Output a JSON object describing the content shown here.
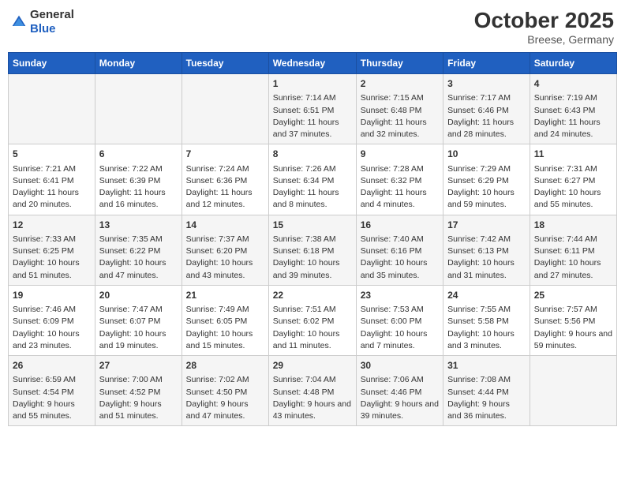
{
  "header": {
    "logo_general": "General",
    "logo_blue": "Blue",
    "month": "October 2025",
    "location": "Breese, Germany"
  },
  "days_of_week": [
    "Sunday",
    "Monday",
    "Tuesday",
    "Wednesday",
    "Thursday",
    "Friday",
    "Saturday"
  ],
  "weeks": [
    [
      {
        "day": "",
        "sunrise": "",
        "sunset": "",
        "daylight": ""
      },
      {
        "day": "",
        "sunrise": "",
        "sunset": "",
        "daylight": ""
      },
      {
        "day": "",
        "sunrise": "",
        "sunset": "",
        "daylight": ""
      },
      {
        "day": "1",
        "sunrise": "Sunrise: 7:14 AM",
        "sunset": "Sunset: 6:51 PM",
        "daylight": "Daylight: 11 hours and 37 minutes."
      },
      {
        "day": "2",
        "sunrise": "Sunrise: 7:15 AM",
        "sunset": "Sunset: 6:48 PM",
        "daylight": "Daylight: 11 hours and 32 minutes."
      },
      {
        "day": "3",
        "sunrise": "Sunrise: 7:17 AM",
        "sunset": "Sunset: 6:46 PM",
        "daylight": "Daylight: 11 hours and 28 minutes."
      },
      {
        "day": "4",
        "sunrise": "Sunrise: 7:19 AM",
        "sunset": "Sunset: 6:43 PM",
        "daylight": "Daylight: 11 hours and 24 minutes."
      }
    ],
    [
      {
        "day": "5",
        "sunrise": "Sunrise: 7:21 AM",
        "sunset": "Sunset: 6:41 PM",
        "daylight": "Daylight: 11 hours and 20 minutes."
      },
      {
        "day": "6",
        "sunrise": "Sunrise: 7:22 AM",
        "sunset": "Sunset: 6:39 PM",
        "daylight": "Daylight: 11 hours and 16 minutes."
      },
      {
        "day": "7",
        "sunrise": "Sunrise: 7:24 AM",
        "sunset": "Sunset: 6:36 PM",
        "daylight": "Daylight: 11 hours and 12 minutes."
      },
      {
        "day": "8",
        "sunrise": "Sunrise: 7:26 AM",
        "sunset": "Sunset: 6:34 PM",
        "daylight": "Daylight: 11 hours and 8 minutes."
      },
      {
        "day": "9",
        "sunrise": "Sunrise: 7:28 AM",
        "sunset": "Sunset: 6:32 PM",
        "daylight": "Daylight: 11 hours and 4 minutes."
      },
      {
        "day": "10",
        "sunrise": "Sunrise: 7:29 AM",
        "sunset": "Sunset: 6:29 PM",
        "daylight": "Daylight: 10 hours and 59 minutes."
      },
      {
        "day": "11",
        "sunrise": "Sunrise: 7:31 AM",
        "sunset": "Sunset: 6:27 PM",
        "daylight": "Daylight: 10 hours and 55 minutes."
      }
    ],
    [
      {
        "day": "12",
        "sunrise": "Sunrise: 7:33 AM",
        "sunset": "Sunset: 6:25 PM",
        "daylight": "Daylight: 10 hours and 51 minutes."
      },
      {
        "day": "13",
        "sunrise": "Sunrise: 7:35 AM",
        "sunset": "Sunset: 6:22 PM",
        "daylight": "Daylight: 10 hours and 47 minutes."
      },
      {
        "day": "14",
        "sunrise": "Sunrise: 7:37 AM",
        "sunset": "Sunset: 6:20 PM",
        "daylight": "Daylight: 10 hours and 43 minutes."
      },
      {
        "day": "15",
        "sunrise": "Sunrise: 7:38 AM",
        "sunset": "Sunset: 6:18 PM",
        "daylight": "Daylight: 10 hours and 39 minutes."
      },
      {
        "day": "16",
        "sunrise": "Sunrise: 7:40 AM",
        "sunset": "Sunset: 6:16 PM",
        "daylight": "Daylight: 10 hours and 35 minutes."
      },
      {
        "day": "17",
        "sunrise": "Sunrise: 7:42 AM",
        "sunset": "Sunset: 6:13 PM",
        "daylight": "Daylight: 10 hours and 31 minutes."
      },
      {
        "day": "18",
        "sunrise": "Sunrise: 7:44 AM",
        "sunset": "Sunset: 6:11 PM",
        "daylight": "Daylight: 10 hours and 27 minutes."
      }
    ],
    [
      {
        "day": "19",
        "sunrise": "Sunrise: 7:46 AM",
        "sunset": "Sunset: 6:09 PM",
        "daylight": "Daylight: 10 hours and 23 minutes."
      },
      {
        "day": "20",
        "sunrise": "Sunrise: 7:47 AM",
        "sunset": "Sunset: 6:07 PM",
        "daylight": "Daylight: 10 hours and 19 minutes."
      },
      {
        "day": "21",
        "sunrise": "Sunrise: 7:49 AM",
        "sunset": "Sunset: 6:05 PM",
        "daylight": "Daylight: 10 hours and 15 minutes."
      },
      {
        "day": "22",
        "sunrise": "Sunrise: 7:51 AM",
        "sunset": "Sunset: 6:02 PM",
        "daylight": "Daylight: 10 hours and 11 minutes."
      },
      {
        "day": "23",
        "sunrise": "Sunrise: 7:53 AM",
        "sunset": "Sunset: 6:00 PM",
        "daylight": "Daylight: 10 hours and 7 minutes."
      },
      {
        "day": "24",
        "sunrise": "Sunrise: 7:55 AM",
        "sunset": "Sunset: 5:58 PM",
        "daylight": "Daylight: 10 hours and 3 minutes."
      },
      {
        "day": "25",
        "sunrise": "Sunrise: 7:57 AM",
        "sunset": "Sunset: 5:56 PM",
        "daylight": "Daylight: 9 hours and 59 minutes."
      }
    ],
    [
      {
        "day": "26",
        "sunrise": "Sunrise: 6:59 AM",
        "sunset": "Sunset: 4:54 PM",
        "daylight": "Daylight: 9 hours and 55 minutes."
      },
      {
        "day": "27",
        "sunrise": "Sunrise: 7:00 AM",
        "sunset": "Sunset: 4:52 PM",
        "daylight": "Daylight: 9 hours and 51 minutes."
      },
      {
        "day": "28",
        "sunrise": "Sunrise: 7:02 AM",
        "sunset": "Sunset: 4:50 PM",
        "daylight": "Daylight: 9 hours and 47 minutes."
      },
      {
        "day": "29",
        "sunrise": "Sunrise: 7:04 AM",
        "sunset": "Sunset: 4:48 PM",
        "daylight": "Daylight: 9 hours and 43 minutes."
      },
      {
        "day": "30",
        "sunrise": "Sunrise: 7:06 AM",
        "sunset": "Sunset: 4:46 PM",
        "daylight": "Daylight: 9 hours and 39 minutes."
      },
      {
        "day": "31",
        "sunrise": "Sunrise: 7:08 AM",
        "sunset": "Sunset: 4:44 PM",
        "daylight": "Daylight: 9 hours and 36 minutes."
      },
      {
        "day": "",
        "sunrise": "",
        "sunset": "",
        "daylight": ""
      }
    ]
  ]
}
